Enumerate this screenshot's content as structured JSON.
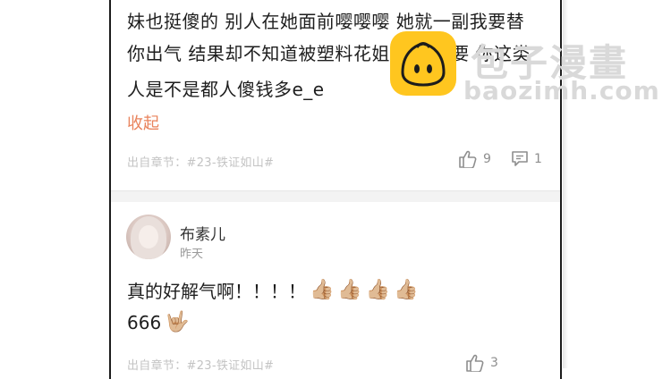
{
  "first_comment": {
    "lines": [
      "妹也挺傻的 别人在她面前嘤嘤嘤 她就一副我要替",
      "你出气 结果却不知道被塑料花姐妹给抢 要 你这类",
      "人是不是都人傻钱多e_e"
    ],
    "collapse_label": "收起",
    "source": "出自章节：#23-铁证如山#",
    "likes": "9",
    "replies": "1"
  },
  "second_comment": {
    "username": "布素儿",
    "time": "昨天",
    "line1": "真的好解气啊！！！！",
    "line1_emojis": [
      "👍🏼",
      "👍🏼",
      "👍🏼",
      "👍🏼"
    ],
    "line2": "666",
    "line2_emoji": "🤟🏼",
    "source": "出自章节：#23-铁证如山#",
    "likes": "3"
  },
  "watermark": {
    "cn": "包子漫畫",
    "en": "baozimh.com"
  },
  "colors": {
    "accent": "#e9835c",
    "logo": "#ffc61f"
  },
  "icons": [
    "thumbs-up-icon",
    "comment-icon",
    "bao-logo-icon"
  ]
}
